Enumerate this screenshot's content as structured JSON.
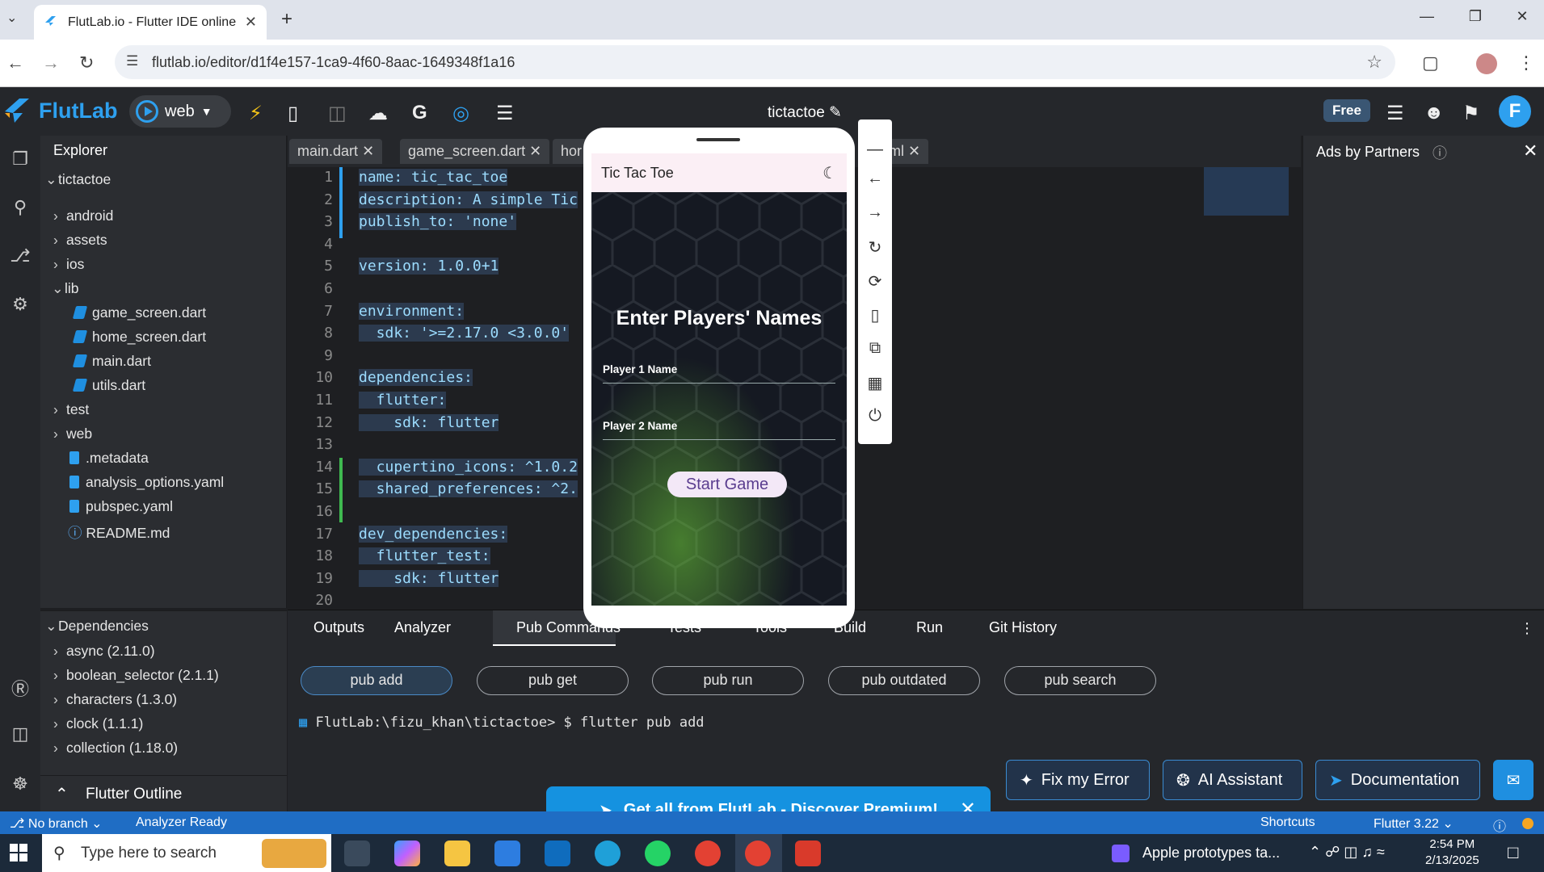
{
  "browser": {
    "tab_title": "FlutLab.io - Flutter IDE online",
    "url": "flutlab.io/editor/d1f4e157-1ca9-4f60-8aac-1649348f1a16"
  },
  "app": {
    "brand": "FlutLab",
    "run_target": "web",
    "project_name": "tictactoe",
    "free_badge": "Free",
    "avatar_letter": "F"
  },
  "explorer": {
    "title": "Explorer",
    "root": "tictactoe",
    "items": [
      {
        "label": "android",
        "kind": "folder"
      },
      {
        "label": "assets",
        "kind": "folder"
      },
      {
        "label": "ios",
        "kind": "folder"
      },
      {
        "label": "lib",
        "kind": "folder-open"
      },
      {
        "label": "game_screen.dart",
        "kind": "dart"
      },
      {
        "label": "home_screen.dart",
        "kind": "dart"
      },
      {
        "label": "main.dart",
        "kind": "dart"
      },
      {
        "label": "utils.dart",
        "kind": "dart"
      },
      {
        "label": "test",
        "kind": "folder"
      },
      {
        "label": "web",
        "kind": "folder"
      },
      {
        "label": ".metadata",
        "kind": "file"
      },
      {
        "label": "analysis_options.yaml",
        "kind": "file"
      },
      {
        "label": "pubspec.yaml",
        "kind": "file"
      },
      {
        "label": "README.md",
        "kind": "info"
      }
    ]
  },
  "dependencies": {
    "title": "Dependencies",
    "items": [
      "async (2.11.0)",
      "boolean_selector (2.1.1)",
      "characters (1.3.0)",
      "clock (1.1.1)",
      "collection (1.18.0)"
    ]
  },
  "outline": {
    "title": "Flutter Outline"
  },
  "editor_tabs": [
    "main.dart",
    "game_screen.dart",
    "hor",
    "ml"
  ],
  "code_lines": [
    "name: tic_tac_toe",
    "description: A simple Tic",
    "publish_to: 'none'",
    "",
    "version: 1.0.0+1",
    "",
    "environment:",
    "  sdk: '>=2.17.0 <3.0.0'",
    "",
    "dependencies:",
    "  flutter:",
    "    sdk: flutter",
    "",
    "  cupertino_icons: ^1.0.2",
    "  shared_preferences: ^2.",
    "",
    "dev_dependencies:",
    "  flutter_test:",
    "    sdk: flutter",
    ""
  ],
  "line_numbers": [
    "1",
    "2",
    "3",
    "4",
    "5",
    "6",
    "7",
    "8",
    "9",
    "10",
    "11",
    "12",
    "13",
    "14",
    "15",
    "16",
    "17",
    "18",
    "19",
    "20"
  ],
  "ads": {
    "title": "Ads by Partners"
  },
  "bottom_tabs": [
    "Outputs",
    "Analyzer",
    "Pub Commands",
    "Tests",
    "Tools",
    "Build",
    "Run",
    "Git History"
  ],
  "pub_buttons": [
    "pub add",
    "pub get",
    "pub run",
    "pub outdated",
    "pub search"
  ],
  "terminal": "FlutLab:\\fizu_khan\\tictactoe> $ flutter pub add",
  "action_buttons": [
    "Fix my Error",
    "AI Assistant",
    "Documentation"
  ],
  "promo": "Get all from FlutLab - Discover Premium!",
  "status": {
    "branch": "No branch",
    "analyzer": "Analyzer Ready",
    "shortcuts": "Shortcuts",
    "flutter_version": "Flutter 3.22"
  },
  "phone": {
    "app_title": "Tic Tac Toe",
    "heading": "Enter Players' Names",
    "player1_label": "Player 1 Name",
    "player2_label": "Player 2 Name",
    "start_button": "Start Game"
  },
  "taskbar": {
    "search_placeholder": "Type here to search",
    "news": "Apple prototypes ta...",
    "time": "2:54 PM",
    "date": "2/13/2025"
  }
}
